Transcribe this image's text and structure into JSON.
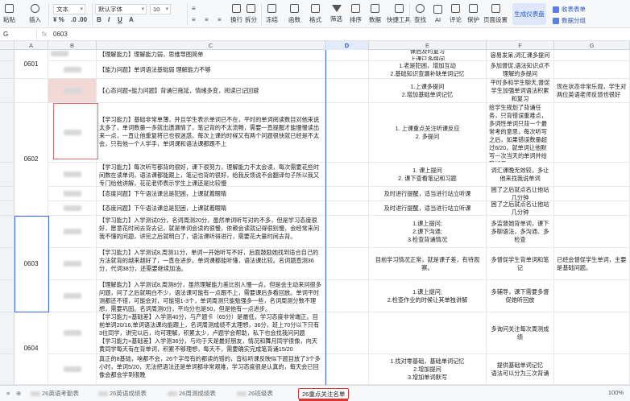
{
  "ribbon": {
    "tools": [
      {
        "name": "paste",
        "label": "粘贴"
      },
      {
        "name": "insert",
        "label": "插入"
      },
      {
        "name": "wrap",
        "label": "换行"
      },
      {
        "name": "merge",
        "label": "拆分"
      },
      {
        "name": "freeze",
        "label": "冻结"
      },
      {
        "name": "function",
        "label": "函数"
      },
      {
        "name": "format",
        "label": "格式"
      },
      {
        "name": "filter",
        "label": "筛选"
      },
      {
        "name": "sort",
        "label": "排序"
      },
      {
        "name": "data",
        "label": "数据"
      },
      {
        "name": "quicktool",
        "label": "快捷工具"
      },
      {
        "name": "find",
        "label": "查找"
      },
      {
        "name": "ai",
        "label": "AI"
      },
      {
        "name": "comment",
        "label": "评论"
      },
      {
        "name": "protect",
        "label": "保护"
      },
      {
        "name": "pagesetup",
        "label": "页面设置"
      }
    ],
    "text_type": "文本",
    "font": "默认字体",
    "size": "10",
    "number_fmt": "¥ %",
    "dec_fmt": ".0 .00",
    "ai_button": "生成仪表盘",
    "side1": "收表表单",
    "side2": "数据分组"
  },
  "formula": {
    "cell": "G",
    "value": "0603"
  },
  "columns": {
    "corner": "",
    "A": "A",
    "B": "B",
    "C": "C",
    "D": "D",
    "E": "E",
    "F": "F",
    "G": "G"
  },
  "rows": [
    {
      "id": "r1",
      "n": "",
      "a": "0601",
      "c": "【理解能力】理解能力弱，思维导图简单",
      "e": "课后及时复习\n上课已多提问",
      "f": "容易发呆,词汇课多提问",
      "g": ""
    },
    {
      "id": "r2",
      "n": "",
      "a": "",
      "c": "【能力问题】单词语法基础弱 理解能力不够",
      "e": "1.老是犯困，增加互动\n2.基础知识查漏补缺单词记忆",
      "f": "多加督促,语法知识点不理解的多提问",
      "g": ""
    },
    {
      "id": "r3",
      "n": "",
      "a": "",
      "c": "【心态问题+能力问题】背诵已拖延，情绪多变，阅读已记回避",
      "e": "1.上课多提问\n2.增加基础单词记忆",
      "f": "平时多和学生聊天,督促学生加强单词语法积累和复习",
      "g": "现在状态非常乐观，学生对两位英语老师反馈也很好"
    },
    {
      "id": "r4",
      "n": "",
      "a": "0602",
      "c": "【学习能力】基础非常单薄，并且学生表示单词已不在，平时的单词阅读数目对他来说太多了，单词数量一多就出遗漏情了，笔记背的不太流畅，需要一直提醒才能慢慢读出来一点，一直让他重复将已也很迷惑，每次上课的时候又有两个问题很快就已经是不太会，只有他一个人学手，单词课和语法课都跟不上",
      "e": "1. 上课重点关注听课反应\n2. 多提问",
      "f": "给学生规划了背诵任务，只背错误重难点，多词性单词只背一个最常考的意思，每次听写之后，如果错误数量超过6/20，就单词让他默写一次当天的单词并给我加员",
      "g": ""
    },
    {
      "id": "r5",
      "n": "",
      "a": "",
      "c": "【学习能力】每次听写都背的很好，课下很努力，理解能力不太会读，每次需要花些时间数在读单词，语法课都能跟上，笔记也背的很好，给我反馈说不会翻译句子所以我又专门给他讲解，花花老师表示学生上课还是比较慢",
      "e": "1. 课上提问\n2. 课下查看笔记和习题",
      "f": "词汇课晚无效较，多让他来找我说单词",
      "g": ""
    },
    {
      "id": "r6",
      "n": "",
      "a": "",
      "c": "【态度问题】下午语法课总是犯困，上课就着眼睛",
      "e": "及时进行提醒，适当进行站立听课",
      "f": "困了之后就点名让他站几分钟",
      "g": ""
    },
    {
      "id": "r7",
      "n": "",
      "a": "",
      "c": "【态度问题】下午语法课总是犯困，上课就着眼睛",
      "e": "及时进行提醒，适当进行站立听课",
      "f": "困了之后就点名让他站几分钟",
      "g": ""
    },
    {
      "id": "r8",
      "n": "",
      "a": "0603",
      "c": "【学习能力】入学测试0分，名词周测20分，虽然单词听写对的不多，但是学习态度很好，愿意花时间去背去记，就是单词会读的很慢，依赖会读就记得很别慢，会经常来问我不懂的问题，讲完之后就明白了，语法课听得进行，需要花大量时间去背。",
      "e": "1.课上提问;\n2.课下沟通;\n3.检查背诵情况",
      "f": "多监督她背单词，课下多聊语法，多沟通、多检查",
      "g": ""
    },
    {
      "id": "r9",
      "n": "",
      "a": "",
      "c": "【学习能力】入学测试8,周测11分，单词一开始听写不好，后面鼓励她找到适合自己的方法就背的越来越好了，一直在进步。单词课都能听懂，语法课比较。名词题直测36分，代词38分，还需要继续加油。",
      "e": "目前学习情况正常，就是课子差，有待观察。",
      "f": "多督促学生背单词和笔记",
      "g": "已经会督促学生单词，主要是基础问题。"
    },
    {
      "id": "r10",
      "n": "",
      "a": "",
      "c": "【理解能力】入学测试8,周测8分，虽然理解能力差比别人慢一点，但是会主动来问很多问题，问了之后就明白不少，语法课可能有一点跟不上，需要课后多看回放。单词平时测都还不错，可能会对，可能错1-3个，单词周测只能勉强多一些，名词周测分数不理想，需要巩固。名词周测0分，平均分也是50，但是他有一点进步。",
      "e": "1.课上提问;\n2.检查作业的时候让其单独讲解",
      "f": "多辅导，课下需要多督促她听回放",
      "g": ""
    },
    {
      "id": "r11",
      "n": "",
      "a": "0604",
      "c": "【学习能力+基础差】入学测40分，与产题卡（65分）是最低，学习态度非常端正。目前单词20/16,单词语法课均能跟上，名词周测成绩不太理想，36分，班上70分以下只有3位同学，讲完以后，均可理解，积累太少，卢题学会帮助，私下也会找我问问题\n【学习能力+基础差】入学测36分，与均于天是最好朋友，情况和舞月同学很像，向天黄同学每天有在背单词，积累不够理想，每天不，需要确实完成笔背诵15/20",
      "e": "",
      "f": "多询问关注每次周测成绩",
      "g": ""
    },
    {
      "id": "r12",
      "n": "",
      "a": "",
      "c": "真正的8基础，啥都不会，26个字母有的都读的错的，音标听课反映似下题目放了3个多小时，单词5/20，无法把语法还是单词都非常艰难，学习态度很是认真的，每天会已回像会都会学到很晚",
      "e": "1.找对零基础，基础单词记忆\n2.增加提问\n3.增加单词默写",
      "f": "提供基础单词记忆\n语法可以分为三次背诵",
      "g": ""
    }
  ],
  "tabs": [
    {
      "label": "26英语考勤表"
    },
    {
      "label": "26英语成绩表"
    },
    {
      "label": "26周测成绩表"
    },
    {
      "label": "26班级表"
    },
    {
      "label": "26重点关注名单"
    }
  ],
  "zoom": "100%"
}
